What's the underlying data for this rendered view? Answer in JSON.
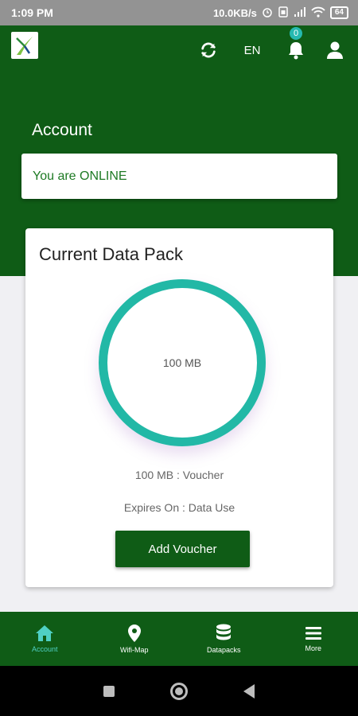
{
  "status_bar": {
    "time": "1:09 PM",
    "network_speed": "10.0KB/s",
    "battery": "64"
  },
  "header": {
    "language": "EN",
    "notification_count": "0",
    "page_title": "Account"
  },
  "connection": {
    "status_text": "You are ONLINE"
  },
  "data_pack": {
    "title": "Current Data Pack",
    "ring_value": "100 MB",
    "pack_name": "100 MB : Voucher",
    "expires": "Expires On : Data Use",
    "add_button": "Add Voucher"
  },
  "bottom_nav": {
    "items": [
      {
        "label": "Account",
        "icon": "home-icon"
      },
      {
        "label": "Wifi-Map",
        "icon": "map-pin-icon"
      },
      {
        "label": "Datapacks",
        "icon": "database-icon"
      },
      {
        "label": "More",
        "icon": "menu-icon"
      }
    ]
  },
  "colors": {
    "brand_green": "#0f5c16",
    "accent_teal": "#22b8a6",
    "online_green": "#1e7a24"
  }
}
